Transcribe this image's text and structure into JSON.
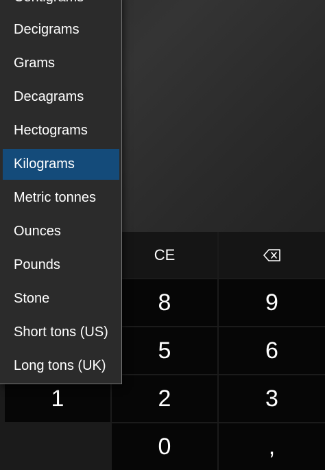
{
  "unit_dropdown": {
    "items": [
      {
        "label": "Centigrams",
        "selected": false
      },
      {
        "label": "Decigrams",
        "selected": false
      },
      {
        "label": "Grams",
        "selected": false
      },
      {
        "label": "Decagrams",
        "selected": false
      },
      {
        "label": "Hectograms",
        "selected": false
      },
      {
        "label": "Kilograms",
        "selected": true
      },
      {
        "label": "Metric tonnes",
        "selected": false
      },
      {
        "label": "Ounces",
        "selected": false
      },
      {
        "label": "Pounds",
        "selected": false
      },
      {
        "label": "Stone",
        "selected": false
      },
      {
        "label": "Short tons (US)",
        "selected": false
      },
      {
        "label": "Long tons (UK)",
        "selected": false
      }
    ],
    "selected_color": "#144b7a"
  },
  "keypad": {
    "ce": "CE",
    "backspace_icon": "backspace-icon",
    "digits": {
      "one": "1",
      "two": "2",
      "three": "3",
      "five": "5",
      "six": "6",
      "eight": "8",
      "nine": "9",
      "zero": "0"
    },
    "decimal": ","
  }
}
